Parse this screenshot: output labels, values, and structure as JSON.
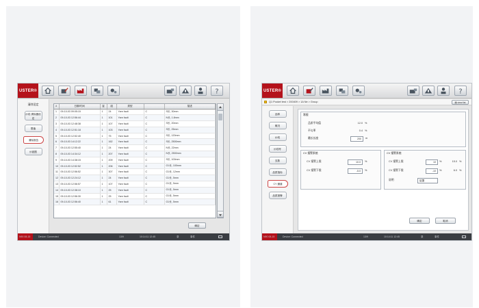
{
  "left_screen": {
    "logo": "USTER®",
    "nav": {
      "heading": "清除设定",
      "buttons": [
        "纱线\n清除器设定",
        "限值",
        "清除报告",
        "纱疵图"
      ]
    },
    "table": {
      "headers": [
        "#",
        "日期/时间",
        "锭",
        "组",
        "类型",
        "",
        "描述"
      ],
      "rows": [
        [
          "1",
          "09-10-03",
          "09:05:15",
          "1",
          "24",
          "Yarn fault",
          "C",
          "S长, 30mm"
        ],
        [
          "2",
          "09-10-03",
          "12:56:44",
          "1",
          "101",
          "Yarn fault",
          "C",
          "N长, 1.8mm"
        ],
        [
          "3",
          "09-10-03",
          "12:48:38",
          "1",
          "107",
          "Yarn fault",
          "C",
          "S长, 20mm"
        ],
        [
          "4",
          "09-10-03",
          "12:51:18",
          "1",
          "103",
          "Yarn fault",
          "C",
          "S长, 25mm"
        ],
        [
          "5",
          "09-10-03",
          "12:52:40",
          "1",
          "75",
          "Yarn fault",
          "C",
          "S长, 120mm"
        ],
        [
          "6",
          "09-10-03",
          "14:12:22",
          "1",
          "162",
          "Yarn fault",
          "C",
          "S长, 2500mm"
        ],
        [
          "7",
          "09-10-03",
          "12:55:40",
          "1",
          "24",
          "Yarn fault",
          "C",
          "N长, 22mm"
        ],
        [
          "8",
          "09-10-03",
          "14:34:12",
          "1",
          "207",
          "Yarn fault",
          "C",
          "N长, 2500mm"
        ],
        [
          "9",
          "09-10-03",
          "14:38:15",
          "1",
          "209",
          "Yarn fault",
          "C",
          "S长, 100mm"
        ],
        [
          "10",
          "09-10-03",
          "12:52:52",
          "1",
          "206",
          "Yarn fault",
          "C",
          "G1长, 100mm"
        ],
        [
          "11",
          "09-10-03",
          "12:56:52",
          "1",
          "307",
          "Yarn fault",
          "C",
          "G1长, 12mm"
        ],
        [
          "12",
          "09-10-03",
          "12:24:12",
          "1",
          "24",
          "Yarn fault",
          "C",
          "G1长, 5mm"
        ],
        [
          "13",
          "09-10-03",
          "12:56:57",
          "1",
          "107",
          "Yarn fault",
          "C",
          "G1长, 5mm"
        ],
        [
          "14",
          "09-10-03",
          "12:38:10",
          "1",
          "25",
          "Yarn fault",
          "C",
          "G1长, 5mm"
        ],
        [
          "15",
          "09-10-03",
          "12:56:30",
          "1",
          "25",
          "Yarn fault",
          "C",
          "G1长, 5mm"
        ],
        [
          "16",
          "09-10-03",
          "12:56:40",
          "1",
          "61",
          "Yarn fault",
          "C",
          "G1长, 5mm"
        ]
      ]
    },
    "confirm_button": "确定",
    "status": [
      "N90 08-15",
      "Device: Connected",
      "13/9",
      "10:14:11  12:45",
      "录",
      "事件"
    ]
  },
  "right_screen": {
    "logo": "USTER®",
    "breadcrumb": "Q1 Pocket test > 200409 > 1A Ne > Group",
    "view_list_label": "▤ view list",
    "nav": [
      "品种",
      "概况",
      "纱线",
      "纱线号",
      "支数",
      "品质指标",
      "CY 通道",
      "品质报警"
    ],
    "group_general": {
      "title": "常规",
      "fields": [
        {
          "label": "品质平均值",
          "value": "12.0",
          "unit": "%"
        },
        {
          "label": "不匀率",
          "value": "0.4",
          "unit": "%"
        },
        {
          "label": "最长长度",
          "value": "200",
          "unit": "m"
        }
      ]
    },
    "group_left": {
      "title": "CV 报警系统",
      "fields": [
        {
          "label": "CV 报警上限",
          "value": "10.0",
          "unit": "%"
        },
        {
          "label": "CV 报警下限",
          "value": "-5.0",
          "unit": "%"
        }
      ]
    },
    "group_right": {
      "title": "CV 报警系统",
      "fields": [
        {
          "label": "CV 报警上限",
          "value": "10",
          "unit": "%",
          "extra": "15.0",
          "extra_unit": "%"
        },
        {
          "label": "CV 报警下限",
          "value": "-10",
          "unit": "%",
          "extra": "6.0",
          "extra_unit": "%"
        },
        {
          "label": "说明",
          "value": "锭罩"
        }
      ]
    },
    "buttons": [
      "确定",
      "取消"
    ],
    "status": [
      "N90 08-15",
      "Device: Connected",
      "13/9",
      "10:14:11  12:45",
      "录",
      "事件"
    ]
  },
  "toolbar_icons": [
    "home-icon",
    "edit-icon",
    "factory-icon",
    "chart-icon",
    "settings-icon",
    "machine-icon",
    "alarm-icon",
    "user-icon",
    "help-icon"
  ]
}
